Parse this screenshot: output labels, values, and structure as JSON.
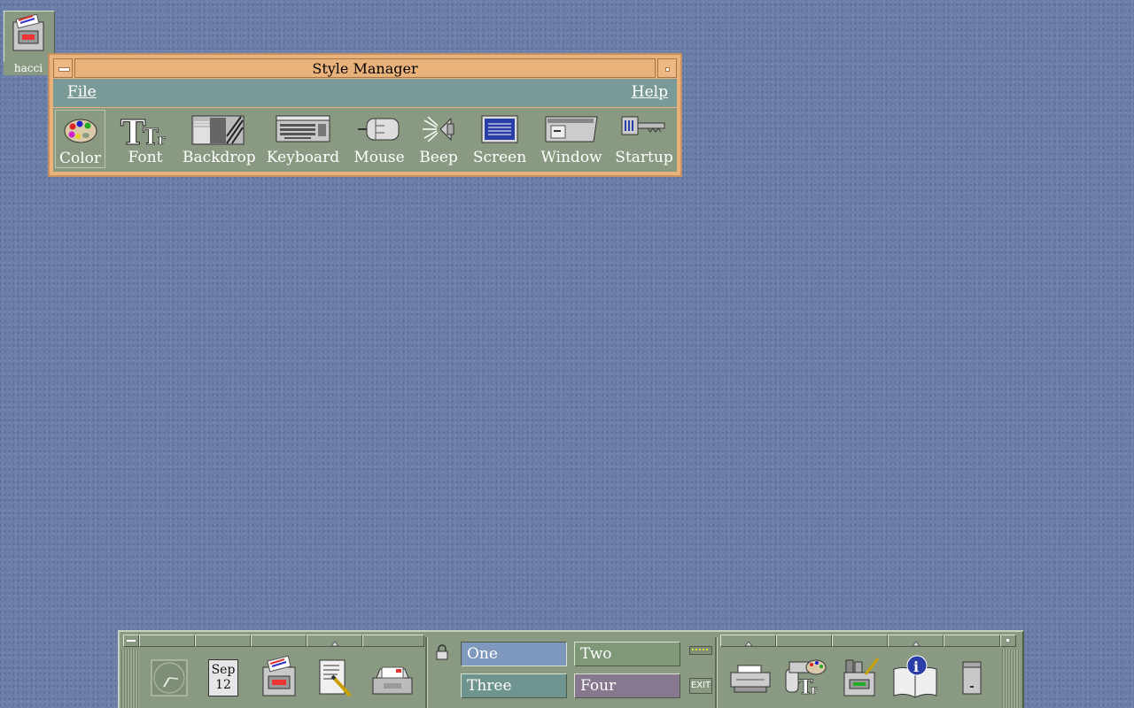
{
  "desktop_icon": {
    "label": "hacci"
  },
  "window": {
    "title": "Style Manager",
    "menus": {
      "file": "File",
      "help": "Help"
    },
    "tools": [
      {
        "label": "Color",
        "icon": "palette-icon",
        "selected": true
      },
      {
        "label": "Font",
        "icon": "font-icon",
        "selected": false
      },
      {
        "label": "Backdrop",
        "icon": "backdrop-icon",
        "selected": false
      },
      {
        "label": "Keyboard",
        "icon": "keyboard-icon",
        "selected": false
      },
      {
        "label": "Mouse",
        "icon": "mouse-icon",
        "selected": false
      },
      {
        "label": "Beep",
        "icon": "speaker-icon",
        "selected": false
      },
      {
        "label": "Screen",
        "icon": "screen-icon",
        "selected": false
      },
      {
        "label": "Window",
        "icon": "window-icon",
        "selected": false
      },
      {
        "label": "Startup",
        "icon": "key-icon",
        "selected": false
      }
    ]
  },
  "front_panel": {
    "calendar": {
      "month": "Sep",
      "day": "12"
    },
    "workspaces": [
      {
        "label": "One",
        "color": "#7f98bd",
        "active": true
      },
      {
        "label": "Two",
        "color": "#7f9878",
        "active": false
      },
      {
        "label": "Three",
        "color": "#6f938f",
        "active": false
      },
      {
        "label": "Four",
        "color": "#86788f",
        "active": false
      }
    ],
    "exit_label": "EXIT"
  },
  "colors": {
    "title_bar": "#e9b27a",
    "menu_bar": "#7a9a98",
    "panel": "#8a9a82",
    "desktop": "#6b7fa8"
  }
}
